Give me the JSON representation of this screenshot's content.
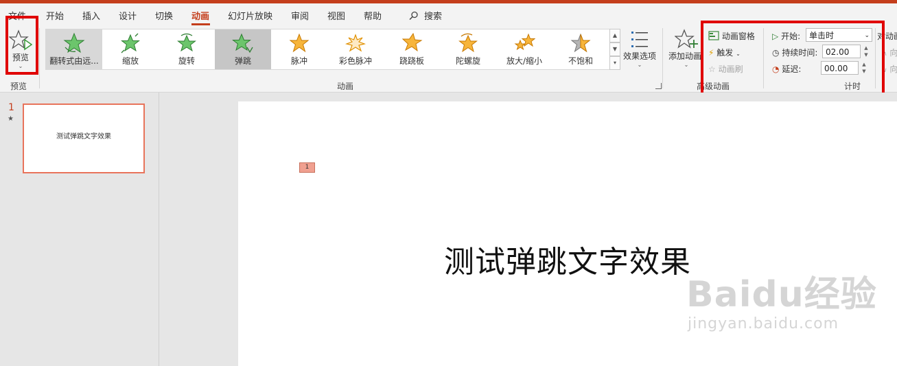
{
  "tabs": [
    {
      "label": "文件"
    },
    {
      "label": "开始"
    },
    {
      "label": "插入"
    },
    {
      "label": "设计"
    },
    {
      "label": "切换"
    },
    {
      "label": "动画"
    },
    {
      "label": "幻灯片放映"
    },
    {
      "label": "审阅"
    },
    {
      "label": "视图"
    },
    {
      "label": "帮助"
    }
  ],
  "active_tab": "动画",
  "search": {
    "label": "搜索"
  },
  "preview": {
    "button_label": "预览",
    "group_label": "预览"
  },
  "animations": {
    "group_label": "动画",
    "items": [
      {
        "label": "翻转式由远...",
        "icon": "flip-star-icon",
        "color": "#4caf50",
        "state": "hover"
      },
      {
        "label": "缩放",
        "icon": "zoom-star-icon",
        "color": "#4caf50"
      },
      {
        "label": "旋转",
        "icon": "spin-star-icon",
        "color": "#4caf50"
      },
      {
        "label": "弹跳",
        "icon": "bounce-star-icon",
        "color": "#4caf50",
        "state": "selected"
      },
      {
        "label": "脉冲",
        "icon": "pulse-star-icon",
        "color": "#f5a623"
      },
      {
        "label": "彩色脉冲",
        "icon": "color-pulse-star-icon",
        "color": "#f5a623"
      },
      {
        "label": "跷跷板",
        "icon": "teeter-star-icon",
        "color": "#f5a623"
      },
      {
        "label": "陀螺旋",
        "icon": "spinner-star-icon",
        "color": "#f5a623"
      },
      {
        "label": "放大/缩小",
        "icon": "grow-shrink-star-icon",
        "color": "#f5a623"
      },
      {
        "label": "不饱和",
        "icon": "desaturate-star-icon",
        "color": "#a0a0a0"
      }
    ],
    "effect_options_label": "效果选项"
  },
  "advanced": {
    "group_label": "高级动画",
    "add_animation_label": "添加动画",
    "pane_label": "动画窗格",
    "trigger_label": "触发",
    "painter_label": "动画刷"
  },
  "timing": {
    "group_label": "计时",
    "start_label": "开始:",
    "start_value": "单击时",
    "duration_label": "持续时间:",
    "duration_value": "02.00",
    "delay_label": "延迟:",
    "delay_value": "00.00",
    "reorder_label": "对动画",
    "earlier_label": "向",
    "later_label": "向"
  },
  "slides_pane": {
    "slide_number": "1",
    "thumb_text": "测试弹跳文字效果"
  },
  "slide": {
    "anim_marker": "1",
    "title": "测试弹跳文字效果"
  },
  "watermark": {
    "line1": "Baidu经验",
    "line2": "jingyan.baidu.com"
  },
  "colors": {
    "accent": "#c43e1c",
    "highlight": "#e00000"
  }
}
